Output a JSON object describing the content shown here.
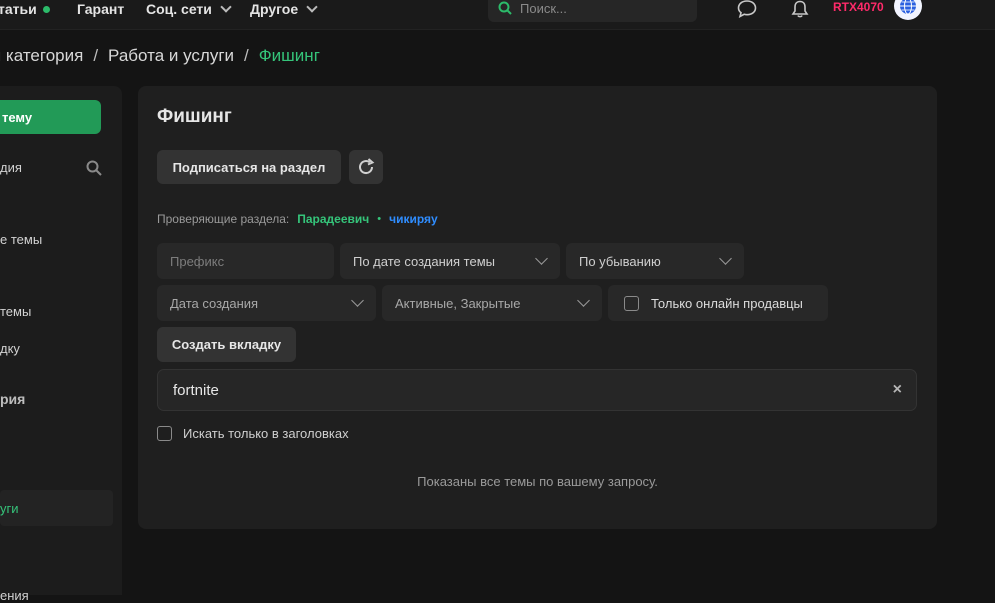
{
  "topnav": {
    "items": [
      "татьи",
      "Гарант",
      "Соц. сети",
      "Другое"
    ],
    "search_placeholder": "Поиск...",
    "username": "RTX4070"
  },
  "breadcrumb": [
    "я категория",
    "/",
    "Работа и услуги",
    "/",
    "Фишинг"
  ],
  "sidebar": {
    "create_button": "тему",
    "items": [
      "дия",
      "е темы",
      "темы",
      "дку",
      "рия",
      "уги",
      "ения"
    ]
  },
  "panel": {
    "title": "Фишинг",
    "subscribe_label": "Подписаться на раздел",
    "reviewers_label": "Проверяющие раздела:",
    "reviewers": [
      "Парадеевич",
      "•",
      "чикиряу"
    ],
    "filters": {
      "prefix_placeholder": "Префикс",
      "sort_by": "По дате создания темы",
      "order": "По убыванию",
      "date_created": "Дата создания",
      "status": "Активные, Закрытые",
      "online_only": "Только онлайн продавцы"
    },
    "create_tab_label": "Создать вкладку",
    "search_value": "fortnite",
    "clear_icon": "×",
    "titles_only_label": "Искать только в заголовках",
    "result_text": "Показаны все темы по вашему запросу."
  }
}
